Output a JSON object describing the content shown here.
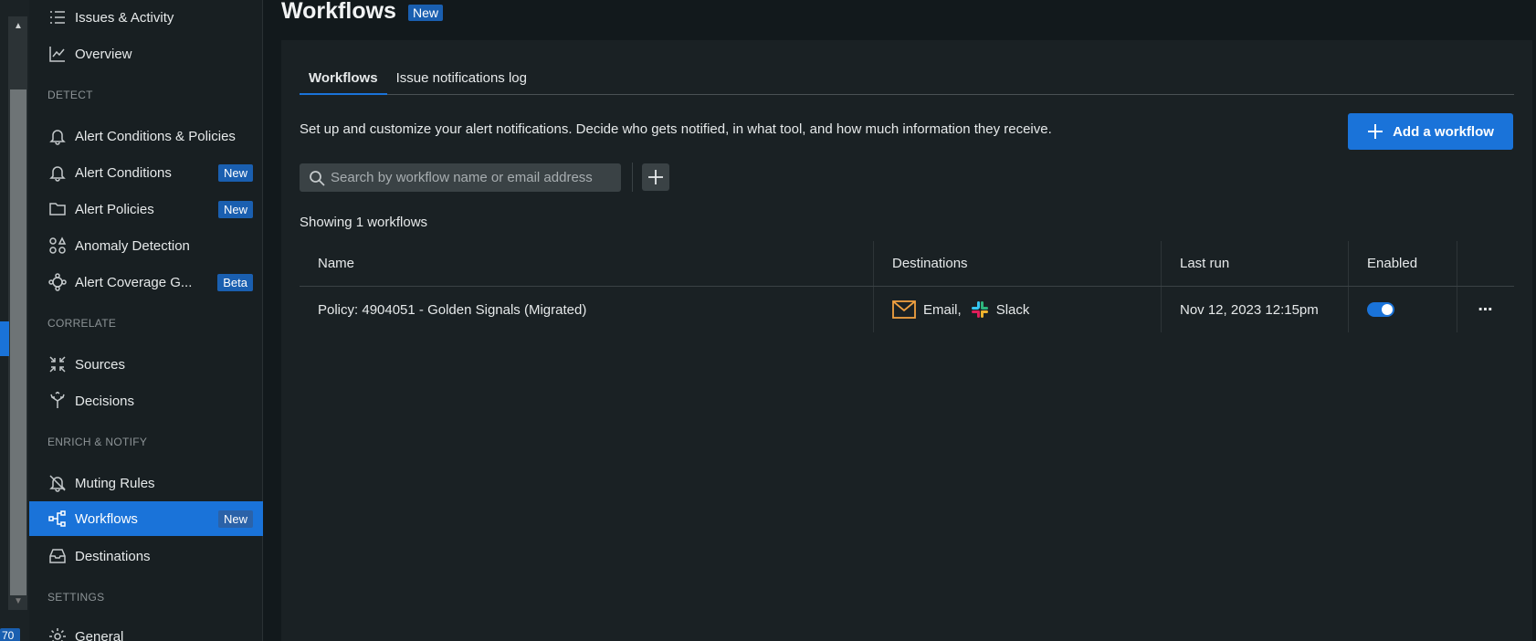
{
  "scrollbar_badge": "70",
  "sidebar": {
    "items": [
      {
        "label": "Issues & Activity",
        "icon": "list-icon",
        "badge": ""
      },
      {
        "label": "Overview",
        "icon": "chart-icon",
        "badge": ""
      },
      {
        "label": "Alert Conditions & Policies",
        "icon": "bell-icon",
        "badge": ""
      },
      {
        "label": "Alert Conditions",
        "icon": "bell-icon",
        "badge": "New"
      },
      {
        "label": "Alert Policies",
        "icon": "folder-icon",
        "badge": "New"
      },
      {
        "label": "Anomaly Detection",
        "icon": "shapes-icon",
        "badge": ""
      },
      {
        "label": "Alert Coverage G...",
        "icon": "coverage-icon",
        "badge": "Beta"
      },
      {
        "label": "Sources",
        "icon": "collapse-arrows-icon",
        "badge": ""
      },
      {
        "label": "Decisions",
        "icon": "split-arrows-icon",
        "badge": ""
      },
      {
        "label": "Muting Rules",
        "icon": "bell-off-icon",
        "badge": ""
      },
      {
        "label": "Workflows",
        "icon": "workflow-icon",
        "badge": "New"
      },
      {
        "label": "Destinations",
        "icon": "inbox-icon",
        "badge": ""
      },
      {
        "label": "General",
        "icon": "gear-icon",
        "badge": ""
      }
    ],
    "sections": {
      "detect": "DETECT",
      "correlate": "CORRELATE",
      "enrich": "ENRICH & NOTIFY",
      "settings": "SETTINGS"
    }
  },
  "header": {
    "title": "Workflows",
    "badge": "New"
  },
  "tabs": [
    {
      "label": "Workflows",
      "active": true
    },
    {
      "label": "Issue notifications log",
      "active": false
    }
  ],
  "description": "Set up and customize your alert notifications. Decide who gets notified, in what tool, and how much information they receive.",
  "add_button_label": "Add a workflow",
  "search": {
    "placeholder": "Search by workflow name or email address",
    "value": ""
  },
  "showing_text": "Showing 1 workflows",
  "table": {
    "columns": [
      "Name",
      "Destinations",
      "Last run",
      "Enabled"
    ],
    "rows": [
      {
        "name": "Policy: 4904051 - Golden Signals (Migrated)",
        "destinations": [
          {
            "label": "Email,",
            "icon": "email-icon"
          },
          {
            "label": "Slack",
            "icon": "slack-icon"
          }
        ],
        "last_run": "Nov 12, 2023 12:15pm",
        "enabled": true,
        "actions_label": "⋯"
      }
    ]
  },
  "colors": {
    "accent": "#1a73d9",
    "background": "#12191c",
    "sidebar": "#181f22",
    "email_icon": "#f0a040"
  }
}
